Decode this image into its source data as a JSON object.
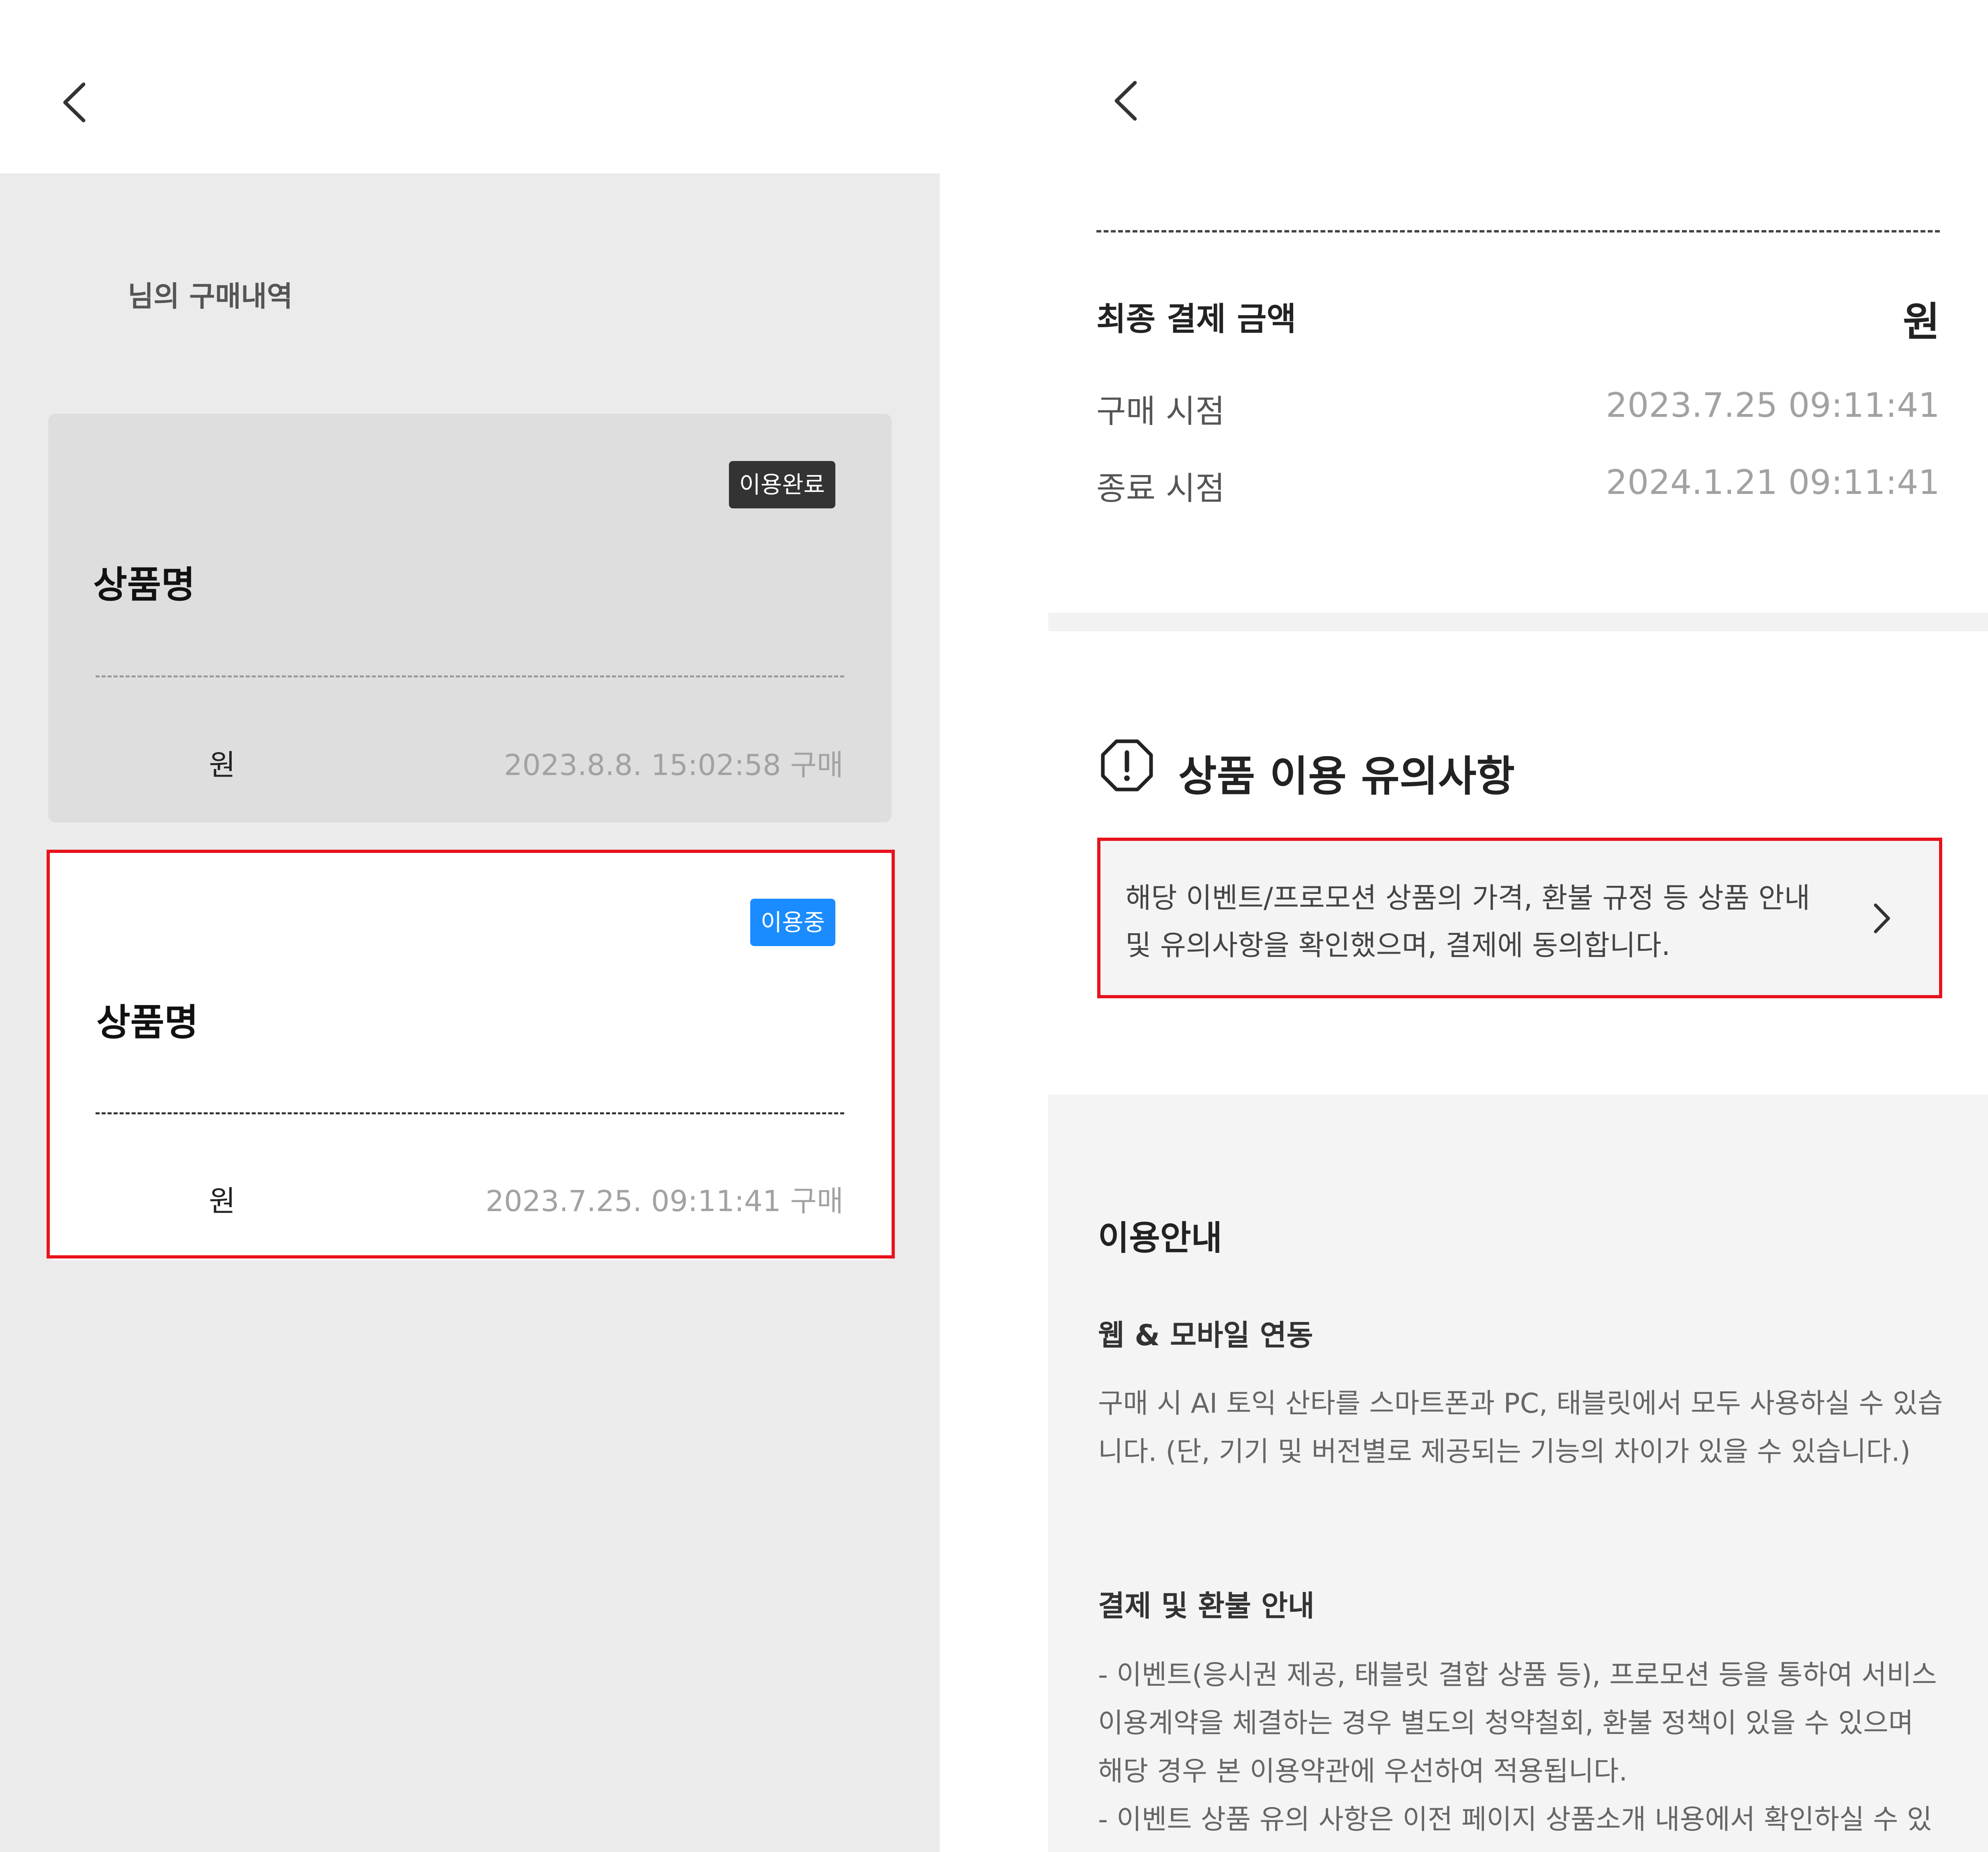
{
  "left_screen": {
    "header": {
      "back_icon": "chevron-left-icon"
    },
    "history_title": "님의 구매내역",
    "cards": [
      {
        "badge": "이용완료",
        "badge_color": "#333333",
        "product_name": "상품명",
        "price_unit": "원",
        "purchase_info": "2023.8.8.  15:02:58 구매"
      },
      {
        "badge": "이용중",
        "badge_color": "#1a8cff",
        "product_name": "상품명",
        "price_unit": "원",
        "purchase_info": "2023.7.25.  09:11:41 구매"
      }
    ]
  },
  "right_screen": {
    "header": {
      "back_icon": "chevron-left-icon"
    },
    "summary": {
      "final_label": "최종 결제 금액",
      "final_value": "원",
      "purchase_label": "구매 시점",
      "purchase_value": "2023.7.25  09:11:41",
      "end_label": "종료 시점",
      "end_value": "2024.1.21  09:11:41"
    },
    "notice": {
      "icon": "exclamation-circle-icon",
      "title": "상품 이용 유의사항",
      "agree_line1": "해당 이벤트/프로모션 상품의 가격, 환불 규정 등 상품 안내",
      "agree_line2": "및 유의사항을 확인했으며, 결제에 동의합니다.",
      "arrow_icon": "chevron-right-icon"
    },
    "guide": {
      "title": "이용안내",
      "section1_title": "웹 & 모바일 연동",
      "section1_line1": "구매 시 AI 토익 산타를 스마트폰과 PC, 태블릿에서 모두 사용하실 수 있습",
      "section1_line2": "니다. (단, 기기 및 버전별로 제공되는 기능의 차이가 있을 수 있습니다.)",
      "section2_title": "결제 및 환불 안내",
      "section2_line1": "- 이벤트(응시권 제공, 태블릿 결합 상품 등), 프로모션 등을 통하여 서비스",
      "section2_line2": "이용계약을 체결하는 경우 별도의 청약철회, 환불 정책이 있을 수 있으며",
      "section2_line3": "해당 경우 본 이용약관에 우선하여 적용됩니다.",
      "section2_line4": "- 이벤트 상품 유의 사항은 이전 페이지 상품소개 내용에서 확인하실 수 있"
    }
  },
  "colors": {
    "highlight": "#e8121b",
    "left_background": "#ebebeb",
    "guide_background": "#f4f4f4"
  }
}
